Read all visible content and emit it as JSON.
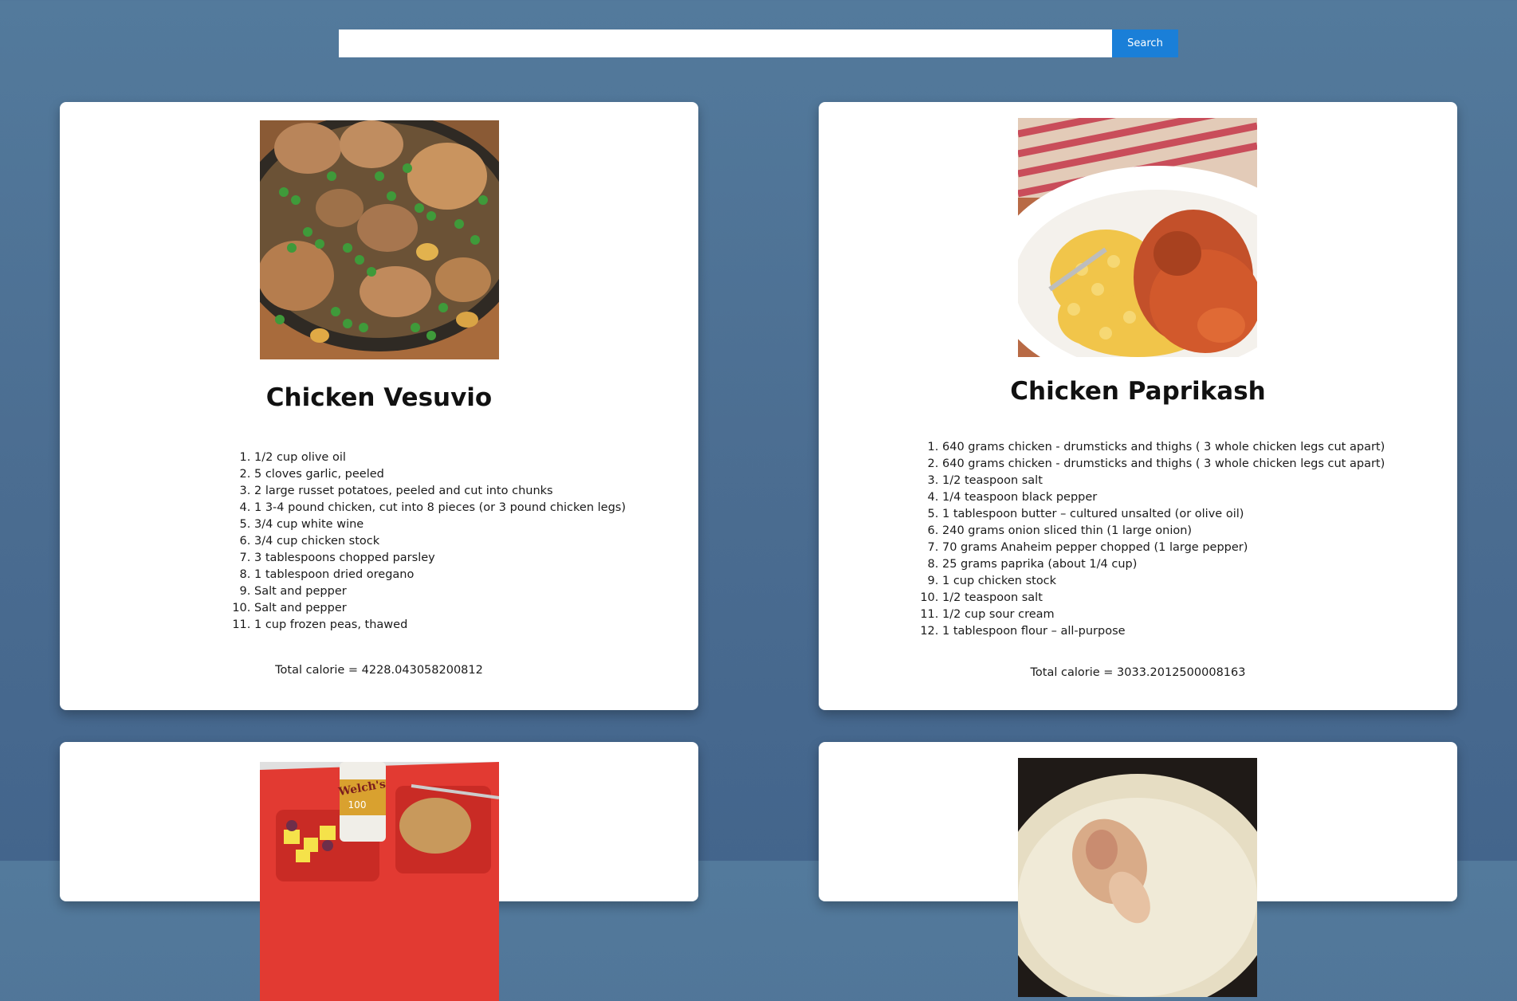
{
  "search": {
    "value": "",
    "placeholder": "",
    "button_label": "Search"
  },
  "colors": {
    "accent": "#1a7fd8",
    "background": "#4b6d91",
    "card": "#ffffff"
  },
  "recipes": [
    {
      "title": "Chicken Vesuvio",
      "image": "chicken-vesuvio-photo",
      "ingredients": [
        "1/2 cup olive oil",
        "5 cloves garlic, peeled",
        "2 large russet potatoes, peeled and cut into chunks",
        "1 3-4 pound chicken, cut into 8 pieces (or 3 pound chicken legs)",
        "3/4 cup white wine",
        "3/4 cup chicken stock",
        "3 tablespoons chopped parsley",
        "1 tablespoon dried oregano",
        "Salt and pepper",
        "Salt and pepper",
        "1 cup frozen peas, thawed"
      ],
      "total_calorie": "Total calorie = 4228.043058200812"
    },
    {
      "title": "Chicken Paprikash",
      "image": "chicken-paprikash-photo",
      "ingredients": [
        "640 grams chicken - drumsticks and thighs ( 3 whole chicken legs cut apart)",
        "640 grams chicken - drumsticks and thighs ( 3 whole chicken legs cut apart)",
        "1/2 teaspoon salt",
        "1/4 teaspoon black pepper",
        "1 tablespoon butter – cultured unsalted (or olive oil)",
        "240 grams onion sliced thin (1 large onion)",
        "70 grams Anaheim pepper chopped (1 large pepper)",
        "25 grams paprika (about 1/4 cup)",
        "1 cup chicken stock",
        "1/2 teaspoon salt",
        "1/2 cup sour cream",
        "1 tablespoon flour – all-purpose"
      ],
      "total_calorie": "Total calorie = 3033.2012500008163"
    },
    {
      "image": "cafeteria-tray-photo",
      "image_text": "Welch's"
    },
    {
      "image": "chicken-drumstick-plate-photo"
    }
  ]
}
